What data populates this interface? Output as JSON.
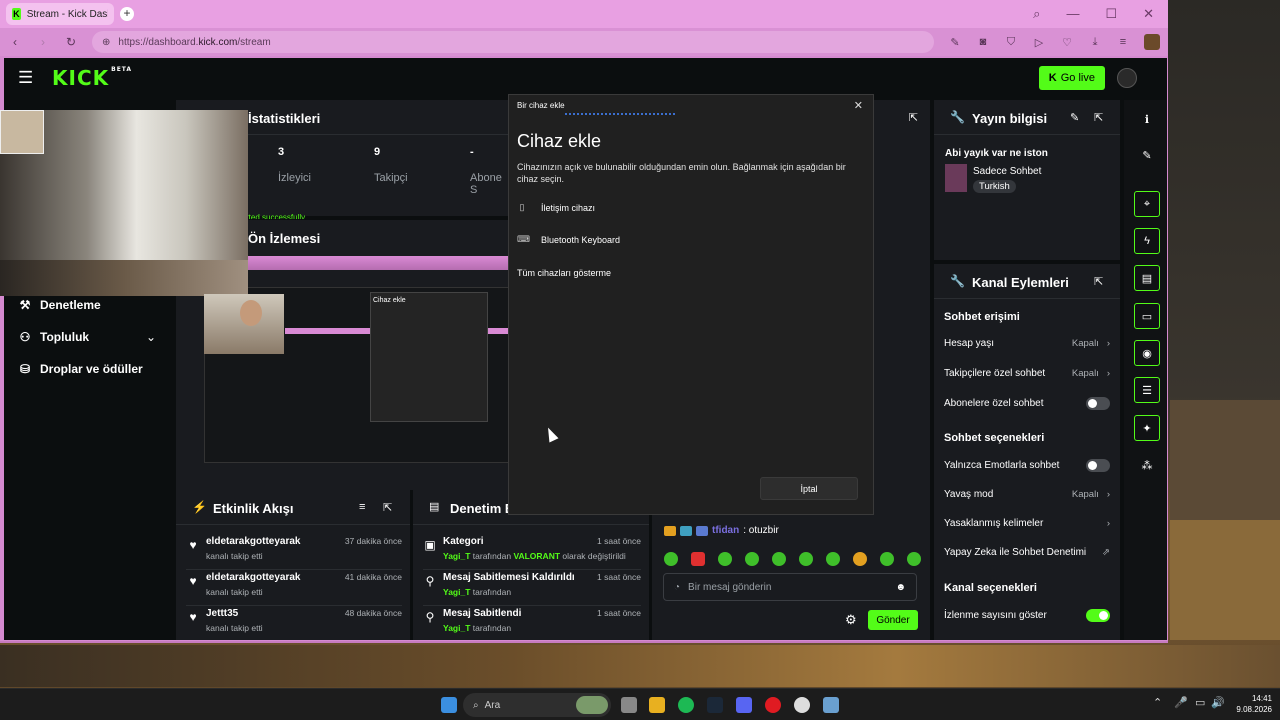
{
  "browser": {
    "tab_title": "Stream - Kick Dashboard",
    "url_prefix": "https://dashboard.",
    "url_domain": "kick.com",
    "url_path": "/stream"
  },
  "kick": {
    "logo": "KICK",
    "beta": "BETA",
    "go_live": "Go live",
    "nav": {
      "denetleme": "Denetleme",
      "topluluk": "Topluluk",
      "droplar": "Droplar ve ödüller"
    },
    "stats": {
      "title": "İstatistikleri",
      "items": [
        {
          "value": "3",
          "label": "İzleyici"
        },
        {
          "value": "9",
          "label": "Takipçi"
        },
        {
          "value": "-",
          "label": "Abone S"
        }
      ]
    },
    "preview_title": "Ön İzlemesi",
    "activity": {
      "title": "Etkinlik Akışı",
      "items": [
        {
          "name": "eldetarakgotteyarak",
          "desc": "kanalı takip etti",
          "time": "37 dakika önce"
        },
        {
          "name": "eldetarakgotteyarak",
          "desc": "kanalı takip etti",
          "time": "41 dakika önce"
        },
        {
          "name": "Jettt35",
          "desc": "kanalı takip etti",
          "time": "48 dakika önce"
        }
      ]
    },
    "moderation": {
      "title": "Denetim E",
      "items": [
        {
          "title": "Kategori",
          "user": "Yagi_T",
          "desc": "tarafından",
          "game": "VALORANT",
          "desc2": "olarak değiştirildi",
          "time": "1 saat önce"
        },
        {
          "title": "Mesaj Sabitlemesi Kaldırıldı",
          "user": "Yagi_T",
          "desc": "tarafından",
          "time": "1 saat önce"
        },
        {
          "title": "Mesaj Sabitlendi",
          "user": "Yagi_T",
          "desc": "tarafından",
          "time": "1 saat önce"
        }
      ]
    },
    "chat": {
      "line_user": "tfidan",
      "line_msg": ": otuzbir",
      "placeholder": "Bir mesaj gönderin",
      "send": "Gönder"
    },
    "stream_info": {
      "title": "Yayın bilgisi",
      "stream_title": "Abi yayık var ne iston",
      "category": "Sadece Sohbet",
      "language": "Turkish"
    },
    "channel_actions": {
      "title": "Kanal Eylemleri",
      "chat_access": "Sohbet erişimi",
      "hesap_yasi": "Hesap yaşı",
      "takipcilere": "Takipçilere özel sohbet",
      "abonelere": "Abonelere özel sohbet",
      "chat_options": "Sohbet seçenekleri",
      "emotes_only": "Yalnızca Emotlarla sohbet",
      "slow_mode": "Yavaş mod",
      "banned_words": "Yasaklanmış kelimeler",
      "ai_mod": "Yapay Zeka ile Sohbet Denetimi",
      "channel_options": "Kanal seçenekleri",
      "show_views": "İzlenme sayısını göster",
      "off": "Kapalı"
    },
    "bg_text": "rted successfully"
  },
  "dialog": {
    "window_title": "Bir cihaz ekle",
    "heading": "Cihaz ekle",
    "description": "Cihazınızın açık ve bulunabilir olduğundan emin olun. Bağlanmak için aşağıdan bir cihaz seçin.",
    "devices": [
      "İletişim cihazı",
      "Bluetooth Keyboard"
    ],
    "show_all": "Tüm cihazları gösterme",
    "cancel": "İptal"
  },
  "taskbar": {
    "search": "Ara",
    "time": "14:41",
    "date": "9.08.2026"
  },
  "colors": {
    "kick_green": "#53fc18",
    "browser_theme": "#d58ad0",
    "panel": "#191b1f"
  }
}
